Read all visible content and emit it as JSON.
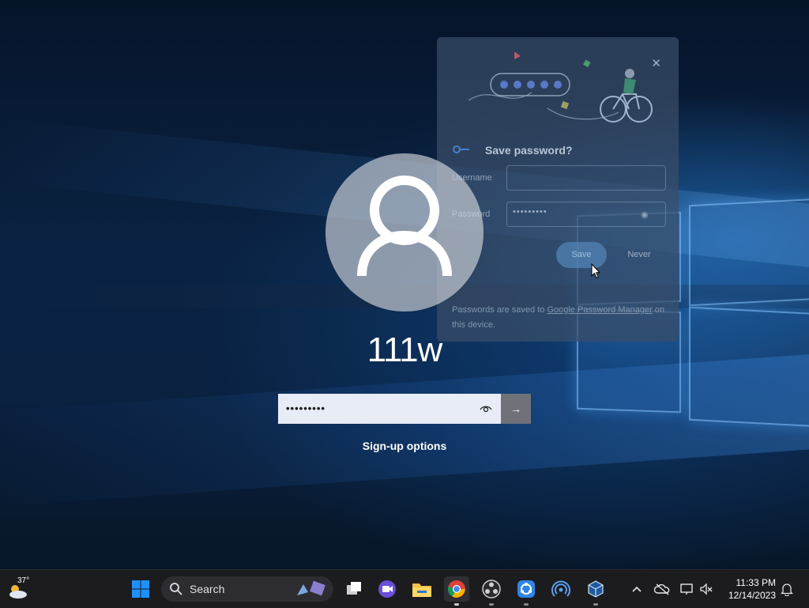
{
  "login": {
    "username": "111w",
    "password_mask": "•••••••••",
    "submit_label": "→",
    "signup_label": "Sign-up options"
  },
  "save_password_dialog": {
    "title": "Save password?",
    "close_label": "✕",
    "username_label": "Username",
    "username_value": "",
    "password_label": "Password",
    "password_mask": "•••••••••",
    "save_label": "Save",
    "never_label": "Never",
    "footer_prefix": "Passwords are saved to ",
    "footer_link": "Google Password Manager",
    "footer_suffix": " on this device."
  },
  "taskbar": {
    "weather_temp": "37°",
    "search_label": "Search",
    "time": "11:33 PM",
    "date": "12/14/2023"
  },
  "colors": {
    "taskbar_bg": "#1c1c1f",
    "accent_blue": "#0078d4",
    "dialog_bg": "#3a4e68"
  },
  "icons": [
    "weather-icon",
    "windows-start-icon",
    "search-icon",
    "task-view-icon",
    "meet-icon",
    "file-explorer-icon",
    "chrome-icon",
    "obs-icon",
    "sync-app-icon",
    "network-app-icon",
    "virtualbox-icon",
    "chevron-up-icon",
    "onedrive-icon",
    "display-icon",
    "volume-muted-icon",
    "notification-bell-icon",
    "reveal-password-icon",
    "arrow-right-icon",
    "key-icon",
    "close-icon",
    "eye-icon",
    "user-icon",
    "mouse-cursor-icon"
  ]
}
